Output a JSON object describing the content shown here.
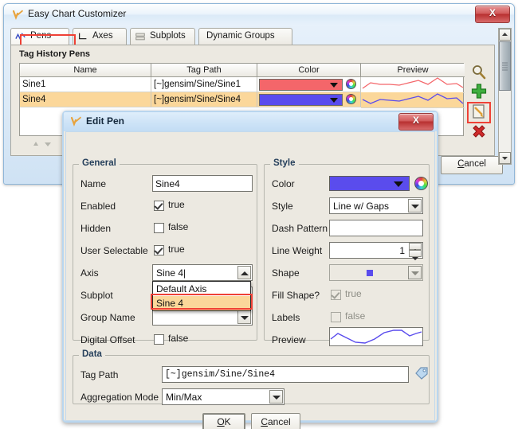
{
  "main_window": {
    "title": "Easy Chart Customizer",
    "title_icon": "pen-check-icon",
    "close_label": "X",
    "tabs": [
      {
        "label": "Pens",
        "icon": "line-chart-icon",
        "selected": true
      },
      {
        "label": "Axes",
        "icon": "axes-icon",
        "selected": false
      },
      {
        "label": "Subplots",
        "icon": "subplots-icon",
        "selected": false
      },
      {
        "label": "Dynamic Groups",
        "icon": "none",
        "selected": false
      }
    ],
    "group_label": "Tag History Pens",
    "table": {
      "columns": [
        "Name",
        "Tag Path",
        "Color",
        "Preview"
      ],
      "rows": [
        {
          "name": "Sine1",
          "tag_path": "[~]gensim/Sine/Sine1",
          "color": "#f4666a",
          "selected": false
        },
        {
          "name": "Sine4",
          "tag_path": "[~]gensim/Sine/Sine4",
          "color": "#5a4ced",
          "selected": true
        }
      ]
    },
    "toolbar": [
      {
        "name": "search-icon",
        "label": "Search"
      },
      {
        "name": "add-icon",
        "label": "Add"
      },
      {
        "name": "edit-icon",
        "label": "Edit",
        "highlighted": true
      },
      {
        "name": "delete-icon",
        "label": "Delete"
      }
    ],
    "cancel_label": "Cancel",
    "selected_row_color": "#fbd79a"
  },
  "dialog": {
    "title": "Edit Pen",
    "title_icon": "pen-check-icon",
    "close_label": "X",
    "general": {
      "legend": "General",
      "fields": [
        {
          "label": "Name",
          "type": "text",
          "value": "Sine4"
        },
        {
          "label": "Enabled",
          "type": "checkbox",
          "checked": true,
          "value": "true"
        },
        {
          "label": "Hidden",
          "type": "checkbox",
          "checked": false,
          "value": "false"
        },
        {
          "label": "User Selectable",
          "type": "checkbox",
          "checked": true,
          "value": "true"
        },
        {
          "label": "Axis",
          "type": "combo-open",
          "value": "Sine 4"
        },
        {
          "label": "Subplot",
          "type": "combo",
          "value": ""
        },
        {
          "label": "Group Name",
          "type": "combo",
          "value": ""
        },
        {
          "label": "Digital Offset",
          "type": "checkbox",
          "checked": false,
          "value": "false"
        }
      ],
      "axis_dropdown": {
        "options": [
          "Default Axis",
          "Sine 4"
        ],
        "selected": "Sine 4"
      }
    },
    "style": {
      "legend": "Style",
      "color_label": "Color",
      "color_value": "#5a4ced",
      "style_label": "Style",
      "style_value": "Line w/ Gaps",
      "dash_label": "Dash Pattern",
      "dash_value": "",
      "weight_label": "Line Weight",
      "weight_value": "1",
      "shape_label": "Shape",
      "shape_value": "square-glyph",
      "fill_label": "Fill Shape?",
      "fill_checked": true,
      "fill_value": "true",
      "labels_label": "Labels",
      "labels_checked": false,
      "labels_value": "false",
      "preview_label": "Preview",
      "preview_color": "#5a4ced"
    },
    "data": {
      "legend": "Data",
      "tag_path_label": "Tag Path",
      "tag_path_value": "[~]gensim/Sine/Sine4",
      "tag_browse_icon": "tag-icon",
      "aggregation_label": "Aggregation Mode",
      "aggregation_value": "Min/Max"
    },
    "buttons": {
      "ok": "OK",
      "cancel": "Cancel"
    }
  }
}
